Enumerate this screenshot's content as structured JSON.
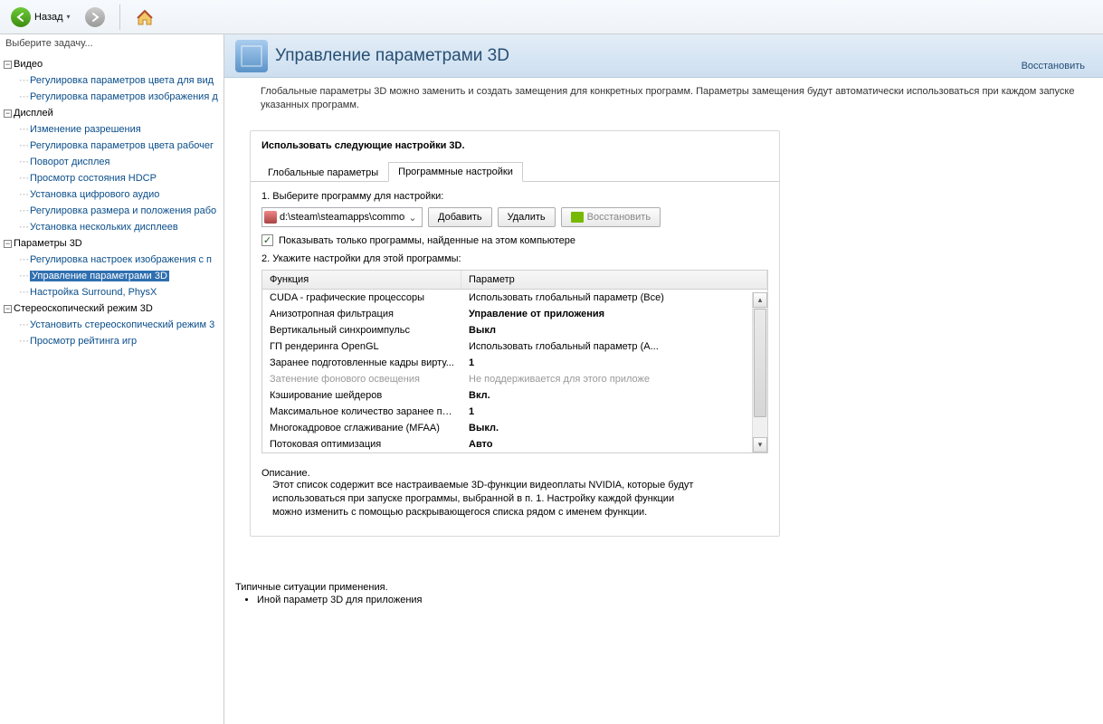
{
  "toolbar": {
    "back": "Назад",
    "back_arrow": "▾"
  },
  "sidebar": {
    "choose": "Выберите задачу...",
    "groups": [
      {
        "name": "Видео",
        "items": [
          "Регулировка параметров цвета для вид",
          "Регулировка параметров изображения д"
        ]
      },
      {
        "name": "Дисплей",
        "items": [
          "Изменение разрешения",
          "Регулировка параметров цвета рабочег",
          "Поворот дисплея",
          "Просмотр состояния HDCP",
          "Установка цифрового аудио",
          "Регулировка размера и положения рабо",
          "Установка нескольких дисплеев"
        ]
      },
      {
        "name": "Параметры 3D",
        "items": [
          "Регулировка настроек изображения с п",
          "Управление параметрами 3D",
          "Настройка Surround, PhysX"
        ],
        "selected": 1
      },
      {
        "name": "Стереоскопический режим 3D",
        "items": [
          "Установить стереоскопический режим 3",
          "Просмотр рейтинга игр"
        ]
      }
    ]
  },
  "header": {
    "title": "Управление параметрами 3D",
    "restore": "Восстановить"
  },
  "intro": "Глобальные параметры 3D можно заменить и создать замещения для конкретных программ. Параметры замещения будут автоматически использоваться при каждом запуске указанных программ.",
  "panel": {
    "title": "Использовать следующие настройки 3D.",
    "tabs": {
      "global": "Глобальные параметры",
      "program": "Программные настройки"
    },
    "step1": "1. Выберите программу для настройки:",
    "program_path": "d:\\steam\\steamapps\\common\\r...",
    "add": "Добавить",
    "del": "Удалить",
    "restore": "Восстановить",
    "show_only": "Показывать только программы, найденные на этом компьютере",
    "step2": "2. Укажите настройки для этой программы:",
    "th_func": "Функция",
    "th_param": "Параметр",
    "rows": [
      {
        "f": "CUDA - графические процессоры",
        "p": "Использовать глобальный параметр (Все)"
      },
      {
        "f": "Анизотропная фильтрация",
        "p": "Управление от приложения",
        "bold": true
      },
      {
        "f": "Вертикальный синхроимпульс",
        "p": "Выкл",
        "bold": true
      },
      {
        "f": "ГП рендеринга OpenGL",
        "p": "Использовать глобальный параметр (A..."
      },
      {
        "f": "Заранее подготовленные кадры вирту...",
        "p": "1",
        "bold": true
      },
      {
        "f": "Затенение фонового освещения",
        "p": "Не поддерживается для этого приложе",
        "disabled": true
      },
      {
        "f": "Кэширование шейдеров",
        "p": "Вкл.",
        "bold": true
      },
      {
        "f": "Максимальное количество заранее под...",
        "p": "1",
        "bold": true
      },
      {
        "f": "Многокадровое сглаживание (MFAA)",
        "p": "Выкл.",
        "bold": true
      },
      {
        "f": "Потоковая оптимизация",
        "p": "Авто",
        "bold": true
      }
    ]
  },
  "desc": {
    "title": "Описание.",
    "body": "Этот список содержит все настраиваемые 3D-функции видеоплаты NVIDIA, которые будут использоваться при запуске программы, выбранной в п. 1. Настройку каждой функции можно изменить с помощью раскрывающегося списка рядом с именем функции."
  },
  "typical": {
    "title": "Типичные ситуации применения.",
    "item": "Иной параметр 3D для приложения"
  }
}
